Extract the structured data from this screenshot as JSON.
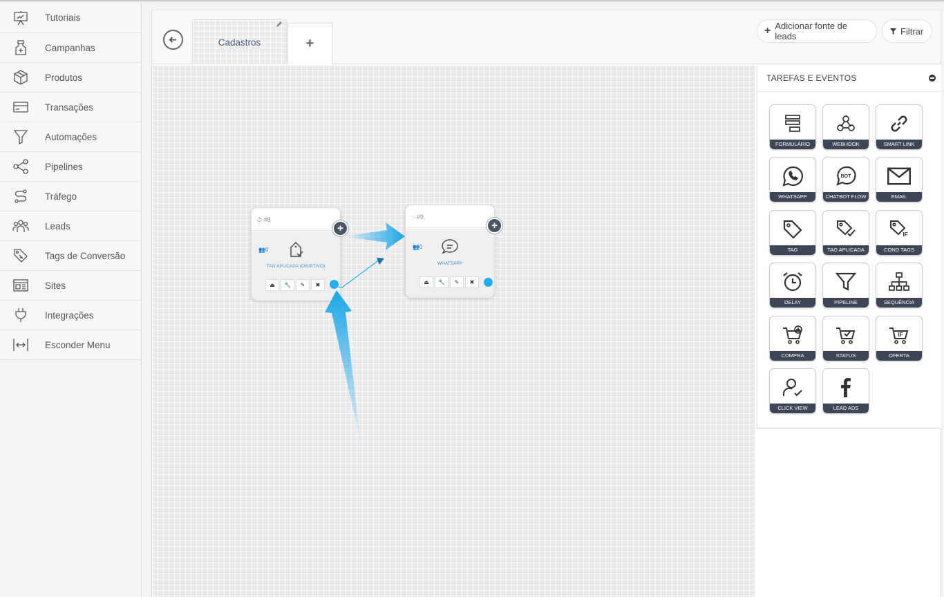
{
  "sidebar": {
    "items": [
      {
        "label": "Tutoriais",
        "icon": "presentation-icon"
      },
      {
        "label": "Campanhas",
        "icon": "bottle-icon"
      },
      {
        "label": "Produtos",
        "icon": "box-icon"
      },
      {
        "label": "Transações",
        "icon": "credit-card-icon"
      },
      {
        "label": "Automações",
        "icon": "funnel-icon"
      },
      {
        "label": "Pipelines",
        "icon": "share-icon"
      },
      {
        "label": "Tráfego",
        "icon": "route-icon"
      },
      {
        "label": "Leads",
        "icon": "users-icon"
      },
      {
        "label": "Tags de Conversão",
        "icon": "tags-icon"
      },
      {
        "label": "Sites",
        "icon": "browser-icon"
      },
      {
        "label": "Integrações",
        "icon": "plug-icon"
      },
      {
        "label": "Esconder Menu",
        "icon": "collapse-icon"
      }
    ]
  },
  "header": {
    "tab_label": "Cadastros",
    "add_tab": "+",
    "add_source": "Adicionar fonte de leads",
    "filter": "Filtrar"
  },
  "nodes": [
    {
      "id": "#8",
      "count": "0",
      "label": "TAG APLICADA (OBJETIVO)",
      "icon": "tag-check-icon"
    },
    {
      "id": "#9",
      "count": "0",
      "label": "WHATSAPP",
      "icon": "chat-icon"
    }
  ],
  "panel": {
    "title": "TAREFAS E EVENTOS",
    "tiles": [
      {
        "label": "FORMULÁRIO",
        "icon": "form-icon"
      },
      {
        "label": "WEBHOOK",
        "icon": "webhook-icon"
      },
      {
        "label": "SMART LINK",
        "icon": "link-icon"
      },
      {
        "label": "WHATSAPP",
        "icon": "whatsapp-icon"
      },
      {
        "label": "CHATBOT FLOW",
        "icon": "bot-icon"
      },
      {
        "label": "EMAIL",
        "icon": "envelope-icon"
      },
      {
        "label": "TAG",
        "icon": "tag-icon"
      },
      {
        "label": "TAG APLICADA",
        "icon": "tag-check-icon"
      },
      {
        "label": "COND TAGS",
        "icon": "tag-if-icon"
      },
      {
        "label": "DELAY",
        "icon": "alarm-icon"
      },
      {
        "label": "PIPELINE",
        "icon": "funnel-icon"
      },
      {
        "label": "SEQUÊNCIA",
        "icon": "hierarchy-icon"
      },
      {
        "label": "COMPRA",
        "icon": "cart-plus-icon"
      },
      {
        "label": "STATUS",
        "icon": "cart-check-icon"
      },
      {
        "label": "OFERTA",
        "icon": "cart-if-icon"
      },
      {
        "label": "CLICK VIEW",
        "icon": "user-check-icon"
      },
      {
        "label": "LEAD ADS",
        "icon": "facebook-icon"
      }
    ]
  },
  "colors": {
    "accent": "#1faef2",
    "dark": "#3d4656",
    "link": "#4a5a78"
  }
}
